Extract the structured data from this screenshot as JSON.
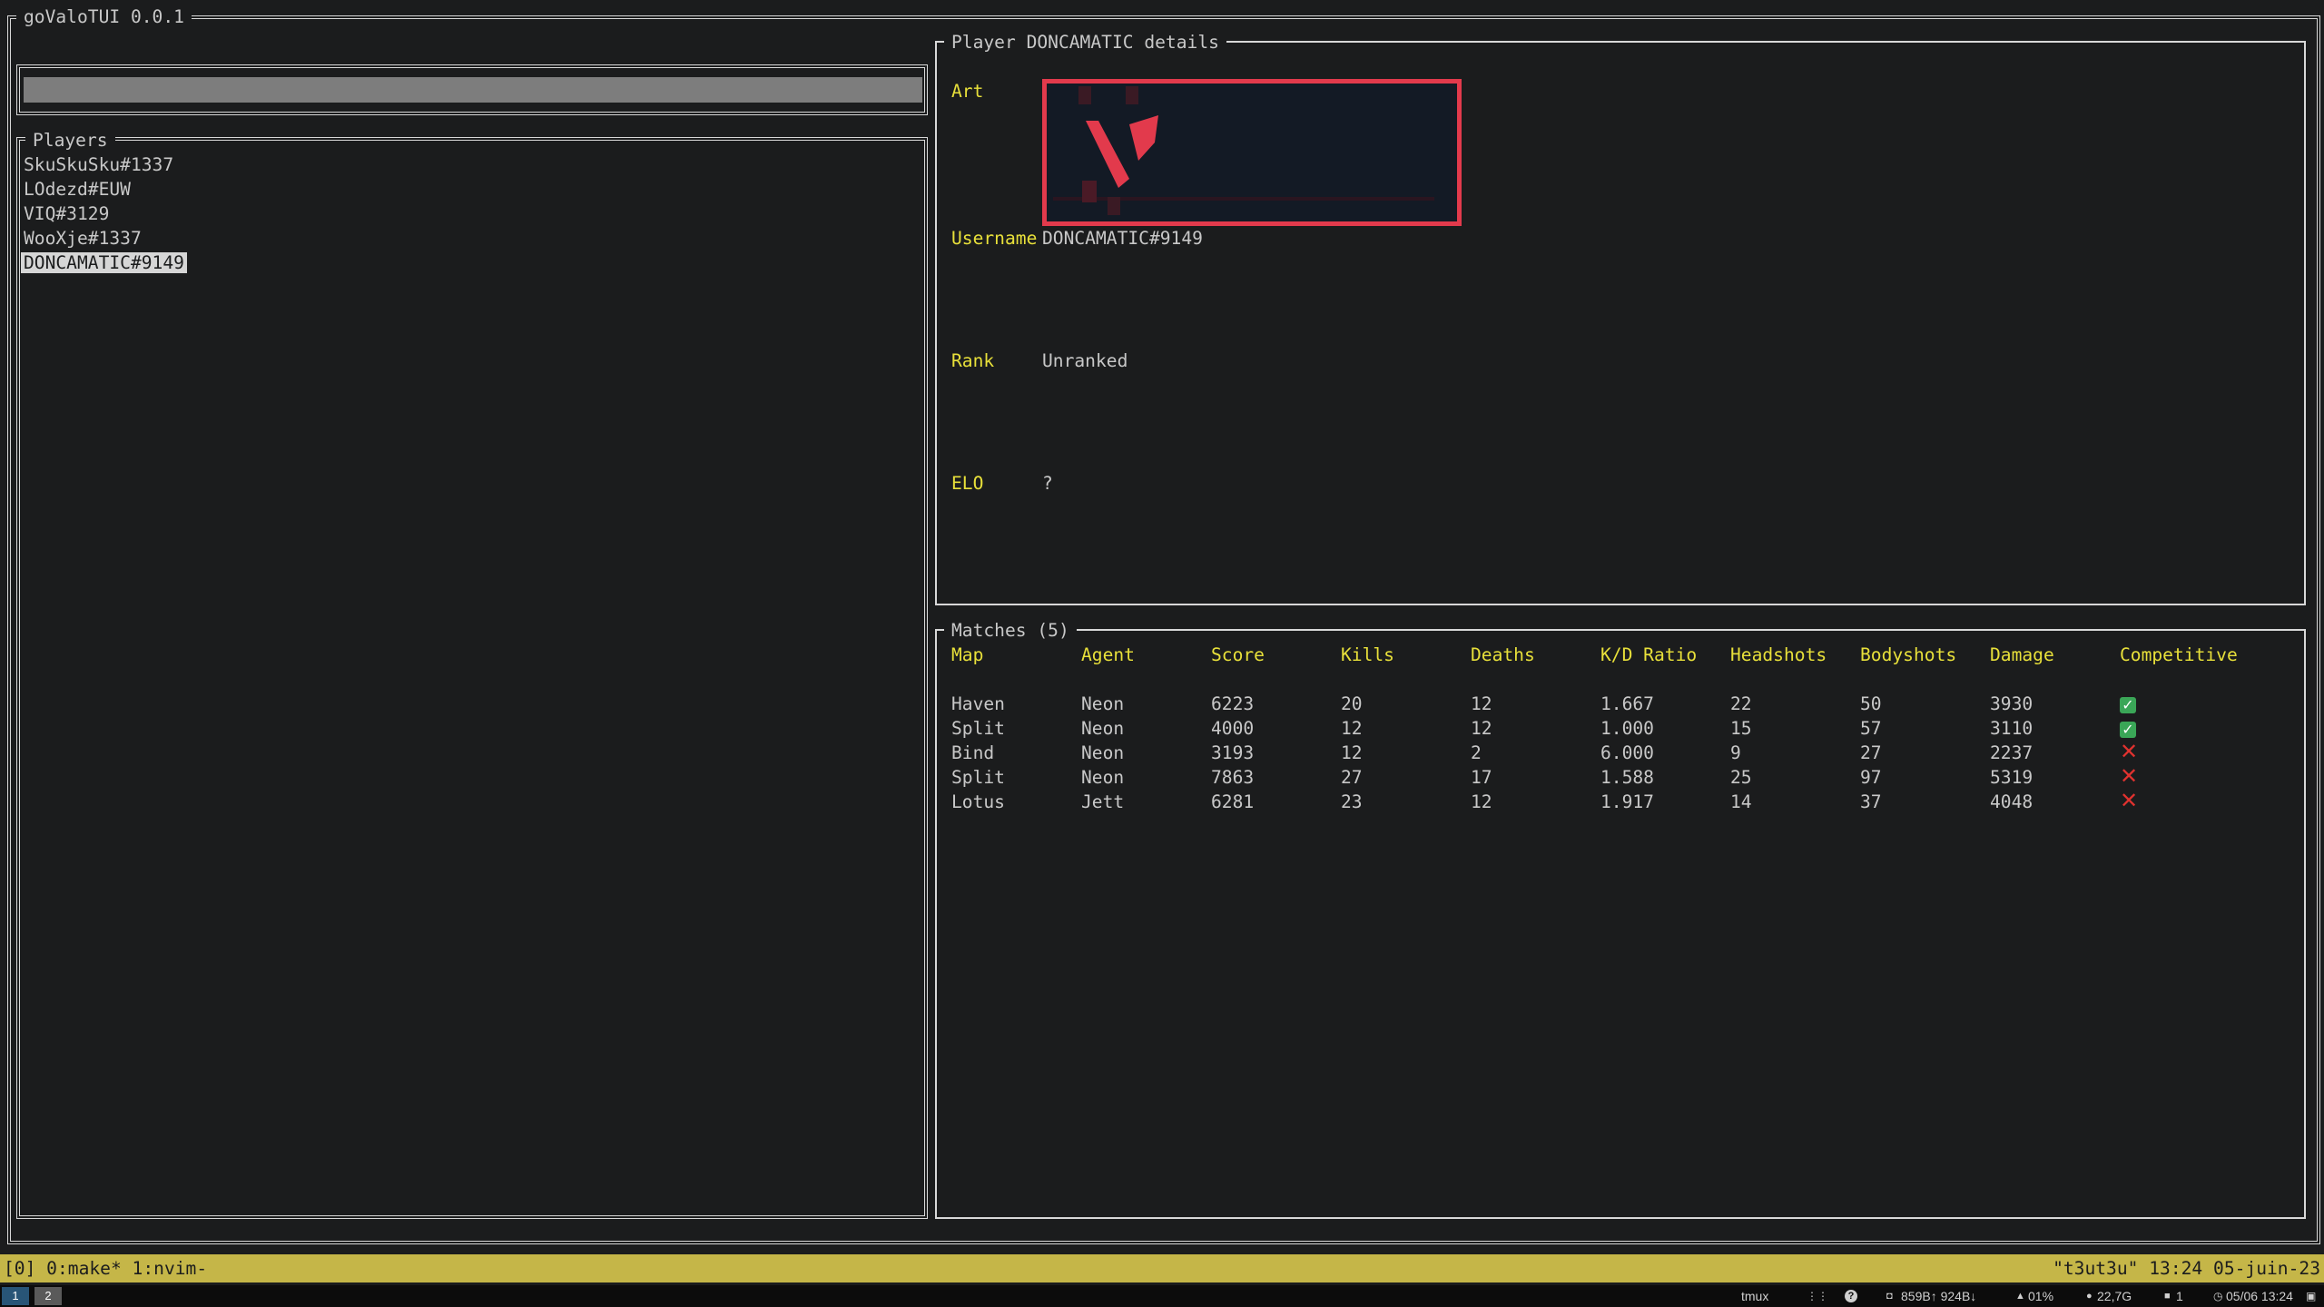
{
  "app": {
    "title": "goValoTUI 0.0.1"
  },
  "search": {
    "value": ""
  },
  "players": {
    "title": "Players",
    "items": [
      {
        "label": "SkuSkuSku#1337"
      },
      {
        "label": "LOdezd#EUW"
      },
      {
        "label": "VIQ#3129"
      },
      {
        "label": "WooXje#1337"
      },
      {
        "label": "DONCAMATIC#9149"
      }
    ],
    "selected_index": 4
  },
  "details": {
    "title": "Player DONCAMATIC details",
    "art_label": "Art",
    "username_label": "Username",
    "username_value": "DONCAMATIC#9149",
    "rank_label": "Rank",
    "rank_value": "Unranked",
    "elo_label": "ELO",
    "elo_value": "?",
    "art_colors": {
      "border": "#e23a4c",
      "background": "#131a25",
      "mark": "#e23a4c"
    }
  },
  "matches": {
    "title": "Matches (5)",
    "headers": [
      "Map",
      "Agent",
      "Score",
      "Kills",
      "Deaths",
      "K/D Ratio",
      "Headshots",
      "Bodyshots",
      "Damage",
      "Competitive"
    ],
    "rows": [
      {
        "map": "Haven",
        "agent": "Neon",
        "score": "6223",
        "kills": "20",
        "deaths": "12",
        "kd": "1.667",
        "headshots": "22",
        "bodyshots": "50",
        "damage": "3930",
        "competitive": true
      },
      {
        "map": "Split",
        "agent": "Neon",
        "score": "4000",
        "kills": "12",
        "deaths": "12",
        "kd": "1.000",
        "headshots": "15",
        "bodyshots": "57",
        "damage": "3110",
        "competitive": true
      },
      {
        "map": "Bind",
        "agent": "Neon",
        "score": "3193",
        "kills": "12",
        "deaths": "2",
        "kd": "6.000",
        "headshots": "9",
        "bodyshots": "27",
        "damage": "2237",
        "competitive": false
      },
      {
        "map": "Split",
        "agent": "Neon",
        "score": "7863",
        "kills": "27",
        "deaths": "17",
        "kd": "1.588",
        "headshots": "25",
        "bodyshots": "97",
        "damage": "5319",
        "competitive": false
      },
      {
        "map": "Lotus",
        "agent": "Jett",
        "score": "6281",
        "kills": "23",
        "deaths": "12",
        "kd": "1.917",
        "headshots": "14",
        "bodyshots": "37",
        "damage": "4048",
        "competitive": false
      }
    ]
  },
  "tmux": {
    "left": "[0] 0:make* 1:nvim-",
    "right": "\"t3ut3u\" 13:24 05-juin-23"
  },
  "taskbar": {
    "workspaces": [
      "1",
      "2"
    ],
    "active_workspace": "1",
    "app_name": "tmux",
    "network": "859B↑ 924B↓",
    "cpu": "01%",
    "memory": "22,7G",
    "notifications": "1",
    "datetime": "05/06 13:24"
  },
  "colors": {
    "background": "#1b1c1d",
    "accent": "#e8e03a",
    "status_bar": "#c5b648",
    "selected_bg": "#d6d6d6",
    "check": "#3aa657",
    "cross": "#e0322f"
  }
}
